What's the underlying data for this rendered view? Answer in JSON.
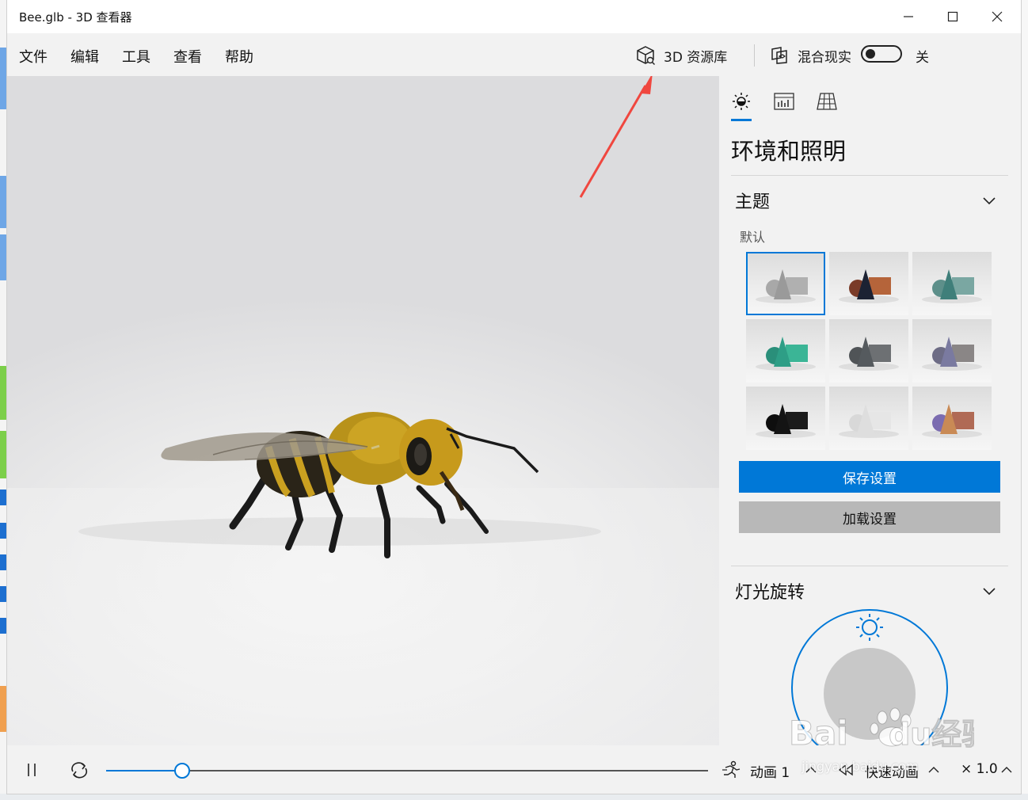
{
  "window": {
    "title": "Bee.glb - 3D 查看器",
    "controls": {
      "minimize": "—",
      "maximize": "☐",
      "close": "✕"
    }
  },
  "menubar": {
    "items": [
      "文件",
      "编辑",
      "工具",
      "查看",
      "帮助"
    ],
    "library_label": "3D 资源库",
    "mixed_reality_label": "混合现实",
    "mixed_reality_state": "关",
    "mixed_reality_on": false
  },
  "panel": {
    "tabs": [
      "environment-lighting",
      "stats",
      "grid"
    ],
    "active_tab": 0,
    "title": "环境和照明",
    "theme_section": "主题",
    "theme_subtitle": "默认",
    "themes": [
      {
        "name": "gray",
        "cone": "#9a9a9a",
        "box": "#b0b0b0",
        "sphere": "#a8a8a8",
        "selected": true
      },
      {
        "name": "dark-copper",
        "cone": "#1c2233",
        "box": "#b5643a",
        "sphere": "#7a3b28",
        "selected": false
      },
      {
        "name": "teal-muted",
        "cone": "#3f7f7a",
        "box": "#7aa7a2",
        "sphere": "#5d8f8a",
        "selected": false
      },
      {
        "name": "green",
        "cone": "#2e9e86",
        "box": "#3bb596",
        "sphere": "#2a8f7a",
        "selected": false
      },
      {
        "name": "dark-gray",
        "cone": "#555a5e",
        "box": "#6d7073",
        "sphere": "#505457",
        "selected": false
      },
      {
        "name": "purple-gray",
        "cone": "#7a7aa0",
        "box": "#8a8686",
        "sphere": "#6d6c85",
        "selected": false
      },
      {
        "name": "black",
        "cone": "#141414",
        "box": "#1b1b1b",
        "sphere": "#0e0e0e",
        "selected": false
      },
      {
        "name": "white",
        "cone": "#dedede",
        "box": "#e6e6e6",
        "sphere": "#d8d8d8",
        "selected": false
      },
      {
        "name": "multicolor",
        "cone": "#c98a55",
        "box": "#b06a55",
        "sphere": "#7b6cb0",
        "selected": false
      }
    ],
    "save_button": "保存设置",
    "load_button": "加载设置",
    "light_section": "灯光旋转"
  },
  "playback": {
    "progress": 0.126,
    "animation_label": "动画 1",
    "speed_label": "快速动画",
    "multiplier": "× 1.0"
  },
  "colors": {
    "accent": "#0078d7",
    "annotation_arrow": "#f0473f"
  },
  "watermark": {
    "text": "Baidu经验",
    "url": "jingyan.baidu.com"
  }
}
